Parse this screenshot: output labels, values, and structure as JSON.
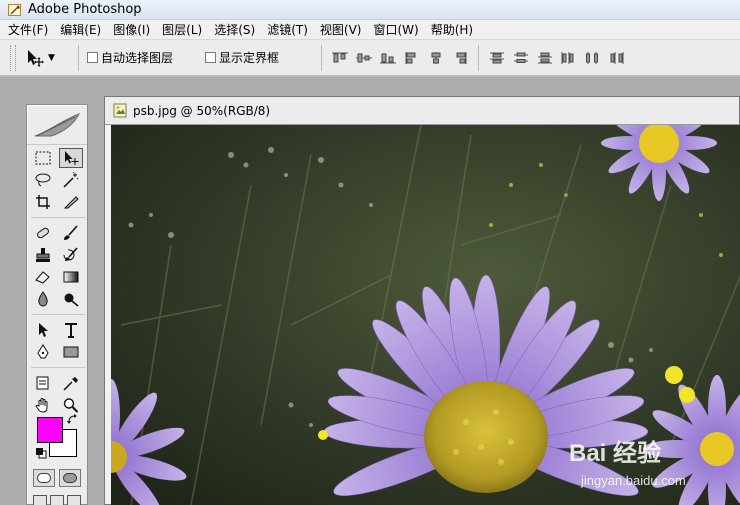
{
  "app": {
    "title": "Adobe Photoshop",
    "icon": "photoshop-feather-icon"
  },
  "menu": [
    {
      "label": "文件(F)"
    },
    {
      "label": "编辑(E)"
    },
    {
      "label": "图像(I)"
    },
    {
      "label": "图层(L)"
    },
    {
      "label": "选择(S)"
    },
    {
      "label": "滤镜(T)"
    },
    {
      "label": "视图(V)"
    },
    {
      "label": "窗口(W)"
    },
    {
      "label": "帮助(H)"
    }
  ],
  "options": {
    "tool": "move-tool-icon",
    "auto_select_label": "自动选择图层",
    "auto_select_checked": false,
    "show_bounds_label": "显示定界框",
    "show_bounds_checked": false
  },
  "toolbox": {
    "tools": [
      "marquee-tool-icon",
      "move-tool-icon",
      "lasso-tool-icon",
      "magic-wand-tool-icon",
      "crop-tool-icon",
      "slice-tool-icon",
      "healing-brush-tool-icon",
      "brush-tool-icon",
      "clone-stamp-tool-icon",
      "history-brush-tool-icon",
      "eraser-tool-icon",
      "gradient-tool-icon",
      "blur-tool-icon",
      "dodge-tool-icon",
      "path-selection-tool-icon",
      "type-tool-icon",
      "pen-tool-icon",
      "rectangle-tool-icon",
      "notes-tool-icon",
      "eyedropper-tool-icon",
      "hand-tool-icon",
      "zoom-tool-icon"
    ],
    "active_tool": "move-tool-icon",
    "foreground_color": "#ff00ff",
    "background_color": "#ffffff"
  },
  "document": {
    "title": "psb.jpg @ 50%(RGB/8)",
    "zoom": "50%",
    "mode": "RGB/8",
    "image_description": "purple aster flowers with yellow centers on dark green foliage"
  },
  "watermark": {
    "brand": "Bai  经验",
    "url": "jingyan.baidu.com"
  }
}
